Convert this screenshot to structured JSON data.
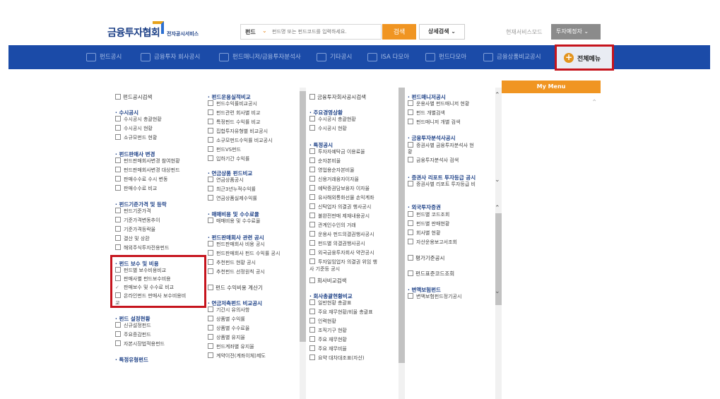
{
  "header": {
    "logo": "금융투자협회",
    "logo_sub": "전자공시서비스",
    "search": {
      "select": "펀드",
      "placeholder": "펀드명 또는 펀드코드를 입력하세요.",
      "button": "검색",
      "advanced": "상세검색"
    },
    "service_mode_label": "현재서비스모드",
    "service_mode_value": "투자예정자"
  },
  "nav": {
    "items": [
      "펀드공시",
      "금융투자 회사공시",
      "펀드매니저/금융투자분석사",
      "기타공시",
      "ISA 다모아",
      "펀드다모아",
      "금융상품비교공시"
    ],
    "all_menu": "전체메뉴"
  },
  "mymenu": "My Menu",
  "col1": {
    "top": "펀드공시검색",
    "g1": "수시공시",
    "g1_items": [
      "수시공시 총괄현황",
      "수시공시 현황",
      "소규모펀드 현황"
    ],
    "g2": "펀드판매사 변경",
    "g2_items": [
      "펀드판매회사변경 참여현황",
      "펀드판매회사변경 대상펀드",
      "판매수수료 수시 변동",
      "판매수수료 비교"
    ],
    "g3": "펀드기준가격 및 등락",
    "g3_items": [
      "펀드기준가격",
      "기준가격변동추이",
      "기준가격등락율",
      "결산 및 상환",
      "해외주식투자전용펀드"
    ],
    "g4": "펀드 보수 및 비용",
    "g4_items": [
      "펀드별 보수비용비교",
      "판매사별 펀드보수비용",
      "판매보수 및 수수료 비교",
      "온라인펀드 판매사 보수비용비",
      "교"
    ],
    "g5": "펀드 설정현황",
    "g5_items": [
      "신규설정펀드",
      "주요증감펀드",
      "자본시장법적용펀드"
    ],
    "g6": "특정유형펀드"
  },
  "col2": {
    "g1": "펀드운용실적비교",
    "g1_items": [
      "펀드수익률비교공시",
      "펀드관련 회사별 비교",
      "특정펀드 수익률 비교",
      "집합투자유형별 비교공시",
      "소규모펀드수익률 비교공시",
      "펀드VS펀드",
      "입하기간 수익률"
    ],
    "g2": "연금상품 펀드비교",
    "g2_items": [
      "연금상품공시",
      "최근3년누적수익률",
      "연금상품실제수익률"
    ],
    "g3": "매매비용 및 수수료율",
    "g3_items": [
      "매매비용 및 수수료율"
    ],
    "g4": "펀드판매회사 관련 공시",
    "g4_items": [
      "펀드판매회사 비용 공시",
      "펀드판매회사 펀드 수익률 공시",
      "추천펀드 현황 공시",
      "추천펀드 선정원칙 공시"
    ],
    "g5": "펀드 수익비용 계산기",
    "g6": "연금저축펀드 비교공시",
    "g6_items": [
      "기간시 유의사항",
      "상품별 수익률",
      "상품별 수수료율",
      "상품별 유지율",
      "펀드계좌별 유지율",
      "계약이전(계좌이체)제도"
    ]
  },
  "col3": {
    "top": "금융투자회사공시검색",
    "g1": "주요경영상황",
    "g1_items": [
      "수시공시 총괄현황",
      "수시공시 현황"
    ],
    "g2": "특정공시",
    "g2_items": [
      "투자자예탁금 이용료율",
      "순자본비율",
      "영업용순자본비율",
      "신용거래융자이자율",
      "예탁증권담보융자 이자율",
      "유사해외통화선물 손익계좌",
      "신탁업자 의결권 행사공시",
      "불완전판매 제재내용공시",
      "관계인수인의 거래",
      "운용사 펀드의결권행사공시",
      "펀드별 의결권행사공시",
      "외국금융투자회사 약관공시",
      "투자일임업자 의결권 위임 행",
      "사 기준등 공시"
    ],
    "g3": "회사비교검색",
    "g4": "회사총괄현황비교",
    "g4_items": [
      "일반현황 총괄표",
      "주요 재무현황/비율 총괄표",
      "인력현황",
      "조직기구 현황",
      "주요 재무현황",
      "주요 재무비율",
      "요약 대차대조표(자산)"
    ]
  },
  "col4": {
    "g1": "펀드매니저공시",
    "g1_items": [
      "운용사별 펀드매니저 현황",
      "펀드 개별검색",
      "펀드매니저 개별 검색"
    ],
    "g2": "금융투자분석사공시",
    "g2_items": [
      "증권사별 금융투자분석사 현",
      "황",
      "금융투자분석사 검색"
    ],
    "g3": "증권사 리포트 투자등급 공시",
    "g3_items": [
      "증권사별 리포트 투자등급 비"
    ],
    "g4": "외국투자증권",
    "g4_items": [
      "펀드별 코드조회",
      "펀드별 판매현황",
      "회사별 현황",
      "자산운용보고서조회"
    ],
    "g5": "평가기준공시",
    "g6": "펀드표준코드조회",
    "g7": "변액보험펀드",
    "g7_items": [
      "변액보험펀드정기공시"
    ]
  },
  "colors": {
    "nav_bg": "#1b4ba8",
    "accent": "#f09522",
    "highlight": "#c6141d",
    "group": "#1b3f86"
  }
}
